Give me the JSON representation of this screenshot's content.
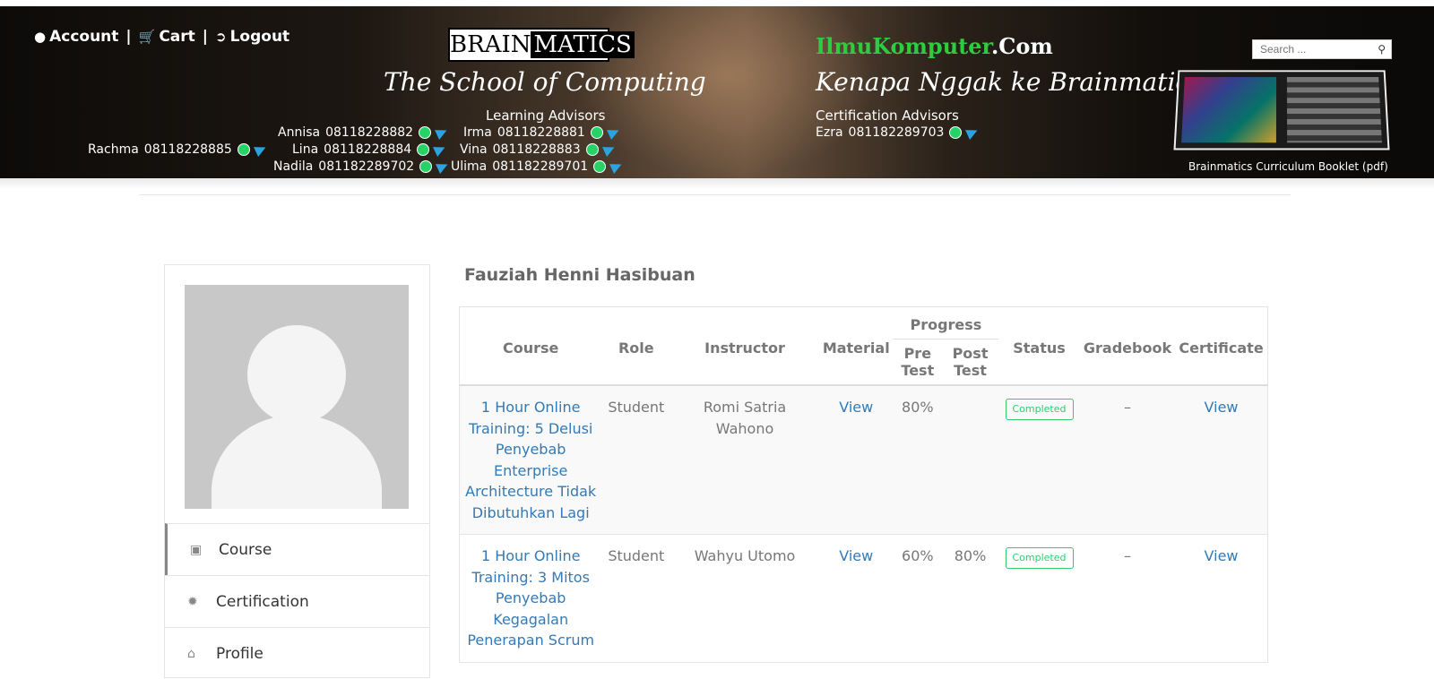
{
  "header": {
    "nav": {
      "account": "Account",
      "cart": "Cart",
      "logout": "Logout",
      "separator": "|"
    },
    "logo_left": "BRAIN",
    "logo_right": "MATICS",
    "tagline_left": "The School of Computing",
    "learning_advisors_title": "Learning Advisors",
    "contacts": [
      {
        "name": "Rachma",
        "phone": "08118228885"
      },
      {
        "name": "Annisa",
        "phone": "08118228882"
      },
      {
        "name": "Lina",
        "phone": "08118228884"
      },
      {
        "name": "Nadila",
        "phone": "081182289702"
      },
      {
        "name": "Irma",
        "phone": "08118228881"
      },
      {
        "name": "Vina",
        "phone": "08118228883"
      },
      {
        "name": "Ulima",
        "phone": "081182289701"
      }
    ],
    "ilmu_green": "IlmuKomputer",
    "ilmu_white": ".Com",
    "tagline_right": "Kenapa Nggak ke Brainmatics Aja?",
    "certification_advisors_title": "Certification Advisors",
    "cert_contact": {
      "name": "Ezra",
      "phone": "081182289703"
    },
    "search_placeholder": "Search ...",
    "booklet_caption": "Brainmatics Curriculum Booklet (pdf)"
  },
  "sidebar": {
    "items": [
      {
        "label": "Course",
        "icon": "book-icon"
      },
      {
        "label": "Certification",
        "icon": "certificate-icon"
      },
      {
        "label": "Profile",
        "icon": "home-icon"
      }
    ]
  },
  "main": {
    "user_name": "Fauziah Henni Hasibuan",
    "columns": {
      "course": "Course",
      "role": "Role",
      "instructor": "Instructor",
      "material": "Material",
      "progress": "Progress",
      "pre_test_1": "Pre",
      "pre_test_2": "Test",
      "post_test_1": "Post",
      "post_test_2": "Test",
      "status": "Status",
      "gradebook": "Gradebook",
      "certificate": "Certificate"
    },
    "rows": [
      {
        "course": "1 Hour Online Training: 5 Delusi Penyebab Enterprise Architecture Tidak Dibutuhkan Lagi",
        "role": "Student",
        "instructor": "Romi Satria Wahono",
        "material": "View",
        "pre_test": "80%",
        "post_test": "",
        "status": "Completed",
        "gradebook": "–",
        "certificate": "View"
      },
      {
        "course": "1 Hour Online Training: 3 Mitos Penyebab Kegagalan Penerapan Scrum",
        "role": "Student",
        "instructor": "Wahyu Utomo",
        "material": "View",
        "pre_test": "60%",
        "post_test": "80%",
        "status": "Completed",
        "gradebook": "–",
        "certificate": "View"
      }
    ]
  },
  "colors": {
    "link": "#337ab7",
    "completed": "#2ecc71",
    "ilmu_green": "#2ecc40"
  }
}
